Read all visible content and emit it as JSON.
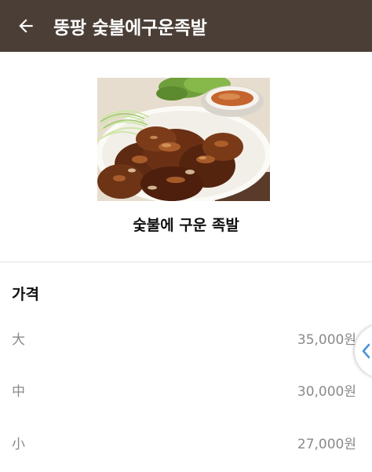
{
  "appbar": {
    "title": "뚱팡 숯불에구운족발",
    "back_icon": "arrow-left-icon",
    "background": "#4a3e36"
  },
  "menu_item": {
    "name": "숯불에 구운 족발",
    "image": "grilled-pork-trotters-photo"
  },
  "price": {
    "header": "가격",
    "rows": [
      {
        "size": "大",
        "price": "35,000원"
      },
      {
        "size": "中",
        "price": "30,000원"
      },
      {
        "size": "小",
        "price": "27,000원"
      }
    ]
  },
  "side_handle": {
    "icon": "chevron-left-icon",
    "accent": "#4a90d9"
  }
}
